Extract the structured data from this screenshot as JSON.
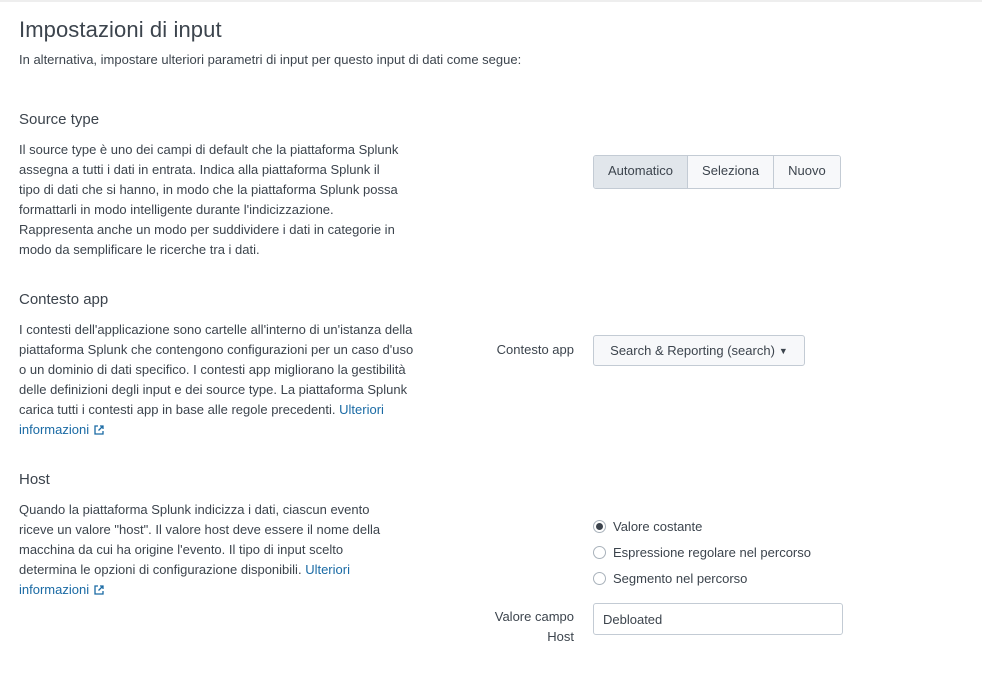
{
  "page": {
    "title": "Impostazioni di input",
    "subtitle": "In alternativa, impostare ulteriori parametri di input per questo input di dati come segue:"
  },
  "source_type": {
    "title": "Source type",
    "description": "Il source type è uno dei campi di default che la piattaforma Splunk assegna a tutti i dati in entrata. Indica alla piattaforma Splunk il tipo di dati che si hanno, in modo che la piattaforma Splunk possa formattarli in modo intelligente durante l'indicizzazione. Rappresenta anche un modo per suddividere i dati in categorie in modo da semplificare le ricerche tra i dati.",
    "buttons": [
      {
        "label": "Automatico",
        "selected": true
      },
      {
        "label": "Seleziona",
        "selected": false
      },
      {
        "label": "Nuovo",
        "selected": false
      }
    ]
  },
  "app_context": {
    "title": "Contesto app",
    "description": "I contesti dell'applicazione sono cartelle all'interno di un'istanza della piattaforma Splunk che contengono configurazioni per un caso d'uso o un dominio di dati specifico. I contesti app migliorano la gestibilità delle definizioni degli input e dei source type. La piattaforma Splunk carica tutti i contesti app in base alle regole precedenti.",
    "link": "Ulteriori informazioni",
    "field_label": "Contesto app",
    "selected_value": "Search & Reporting (search)"
  },
  "host": {
    "title": "Host",
    "description": "Quando la piattaforma Splunk indicizza i dati, ciascun evento riceve un valore \"host\". Il valore host deve essere il nome della macchina da cui ha origine l'evento. Il tipo di input scelto determina le opzioni di configurazione disponibili.",
    "link": "Ulteriori informazioni",
    "options": [
      {
        "label": "Valore costante",
        "checked": true
      },
      {
        "label": "Espressione regolare nel percorso",
        "checked": false
      },
      {
        "label": "Segmento nel percorso",
        "checked": false
      }
    ],
    "field_label_line1": "Valore campo",
    "field_label_line2": "Host",
    "field_value": "Debloated"
  },
  "icons": {
    "external_link": "external-link-icon",
    "caret": "caret-down-icon"
  },
  "colors": {
    "text": "#3c444d",
    "link": "#1a6aa4",
    "border": "#c3cbd4",
    "button_active": "#e1e6eb"
  }
}
